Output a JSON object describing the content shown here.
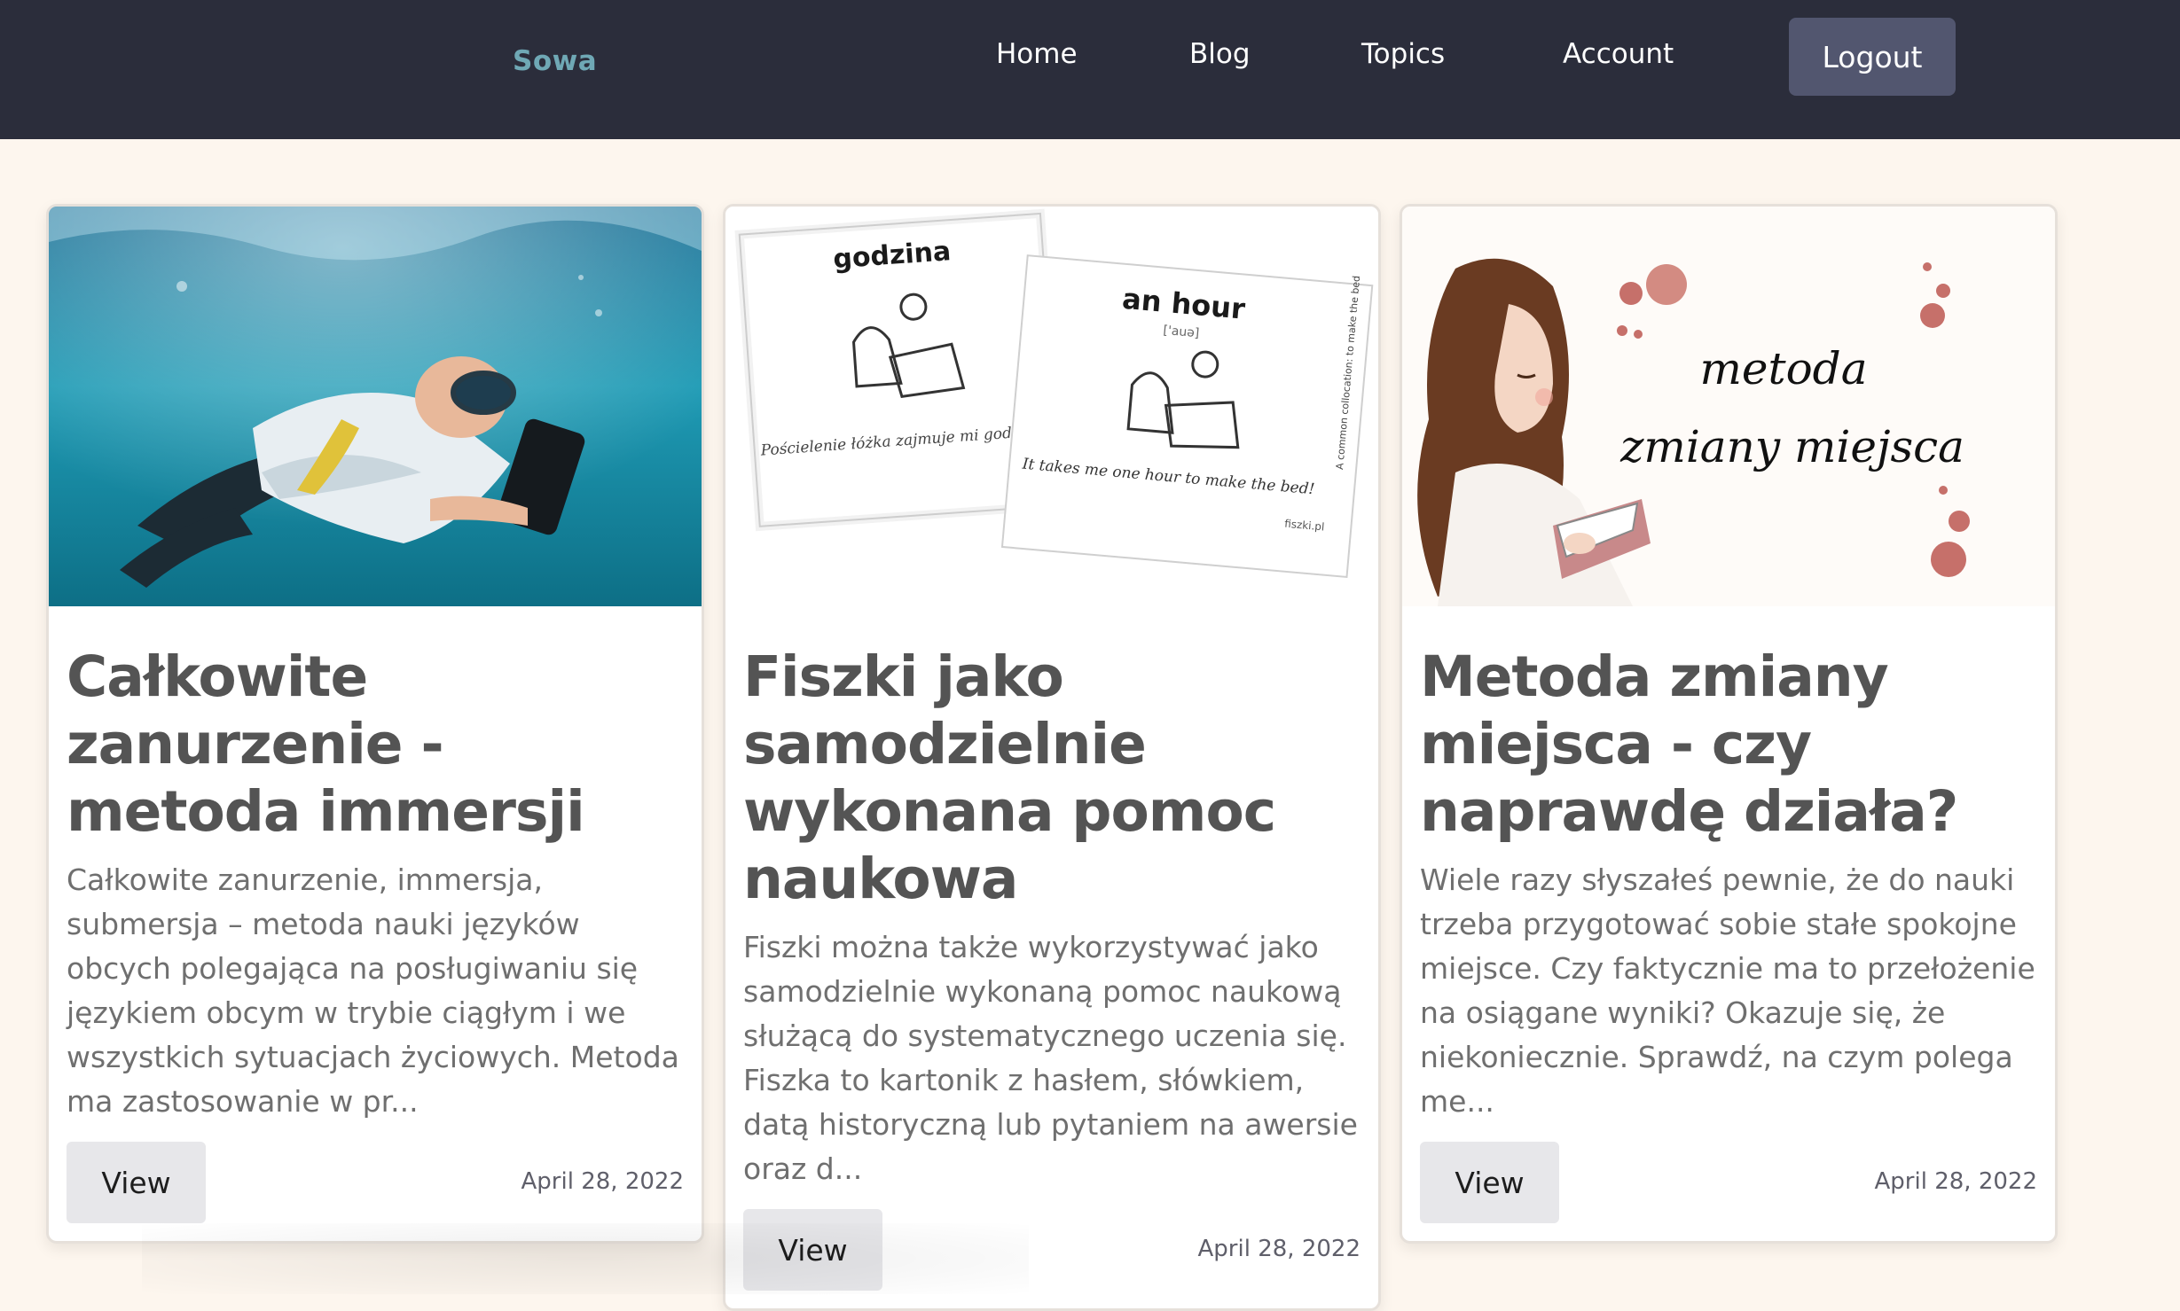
{
  "nav": {
    "brand": "Sowa",
    "items": [
      "Home",
      "Blog",
      "Topics",
      "Account"
    ],
    "logout": "Logout"
  },
  "cards": [
    {
      "title": "Całkowite zanurzenie - metoda immersji",
      "excerpt": "Całkowite zanurzenie, immersja, submersja – metoda nauki języków obcych polegająca na posługiwaniu się językiem obcym w trybie ciągłym i we wszystkich sytuacjach życiowych. Metoda ma zastosowanie w pr...",
      "view": "View",
      "date": "April 28, 2022"
    },
    {
      "title": "Fiszki jako samodzielnie wykonana pomoc naukowa",
      "excerpt": "Fiszki można także wykorzystywać jako samodzielnie wykonaną pomoc naukową służącą do systematycznego uczenia się. Fiszka to kartonik z hasłem, słówkiem, datą historyczną lub pytaniem na awersie oraz d...",
      "view": "View",
      "date": "April 28, 2022",
      "image": {
        "card1_word": "godzina",
        "card1_caption": "Pościelenie łóżka zajmuje mi godzinę!",
        "card2_word": "an hour",
        "card2_phonetic": "['auə]",
        "card2_caption": "It takes me one hour to make the bed!",
        "card2_side": "A common collocation: to make the bed",
        "card2_brand": "fiszki.pl"
      }
    },
    {
      "title": "Metoda zmiany miejsca - czy naprawdę działa?",
      "excerpt": "Wiele razy słyszałeś pewnie, że do nauki trzeba przygotować sobie stałe spokojne miejsce. Czy faktycznie ma to przełożenie na osiągane wyniki? Okazuje się, że niekoniecznie. Sprawdź, na czym polega me...",
      "view": "View",
      "date": "April 28, 2022",
      "image": {
        "line1": "metoda",
        "line2": "zmiany miejsca"
      }
    }
  ],
  "colors": {
    "navbar_bg": "#2b2d3b",
    "page_bg": "#fdf6ee",
    "brand": "#6fa8b5",
    "logout_bg": "#52566f",
    "title": "#545454",
    "text": "#6f6f6f"
  }
}
